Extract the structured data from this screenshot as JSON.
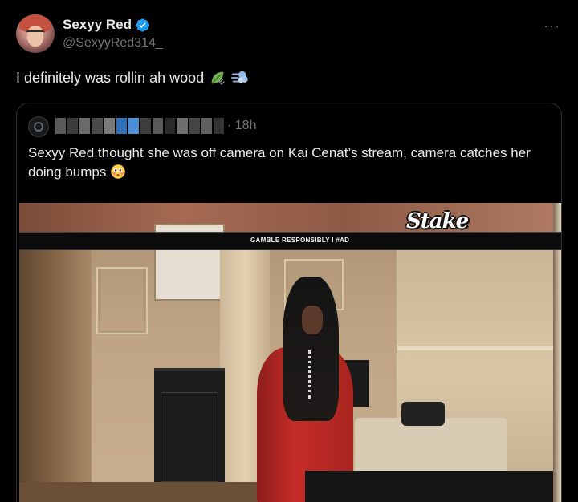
{
  "author": {
    "display_name": "Sexyy Red",
    "handle": "@SexyyRed314_",
    "verified": true,
    "avatar": "profile-photo"
  },
  "more_icon": "more-options-icon",
  "tweet": {
    "text": "I definitely was rollin ah wood",
    "emojis": [
      "leaf-fluttering-in-wind-emoji",
      "dashing-away-emoji"
    ]
  },
  "quote": {
    "author_blurred": true,
    "time": "· 18h",
    "text": "Sexyy Red thought she was off camera on Kai Cenat’s stream, camera catches her doing bumps",
    "emoji": "flushed-face-emoji",
    "media": {
      "type": "video-frame",
      "banner_text": "GAMBLE RESPONSIBLY  I  #AD",
      "logo_text": "Stake"
    }
  },
  "colors": {
    "background": "#000000",
    "text_primary": "#e7e9ea",
    "text_secondary": "#71767b",
    "verified_blue": "#1d9bf0",
    "border": "#2f3336",
    "dress_red": "#c52c27"
  }
}
